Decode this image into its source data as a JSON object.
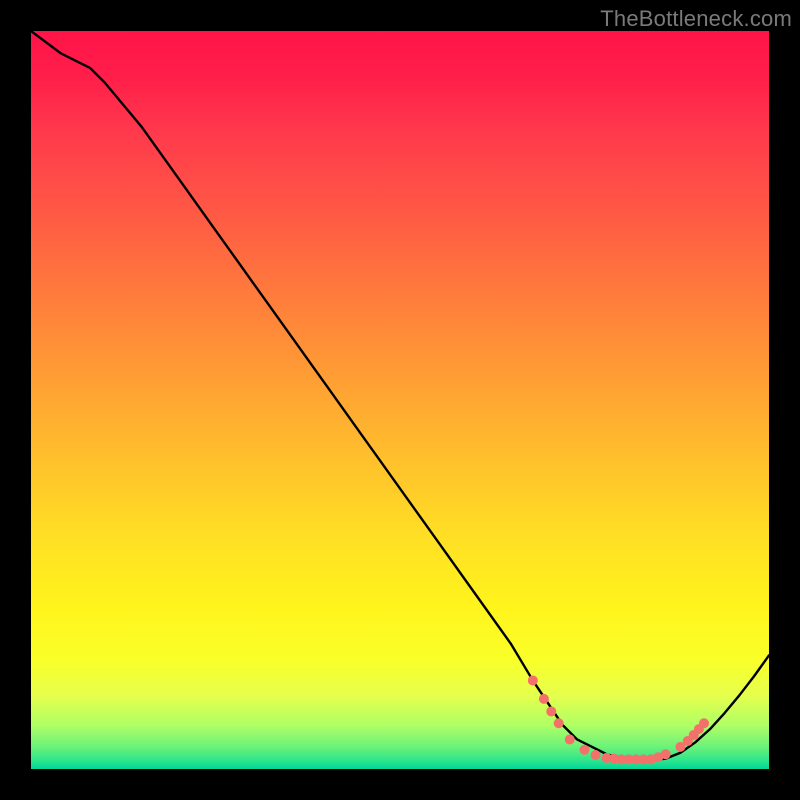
{
  "watermark": "TheBottleneck.com",
  "chart_data": {
    "type": "line",
    "title": "",
    "xlabel": "",
    "ylabel": "",
    "xlim": [
      0,
      100
    ],
    "ylim": [
      0,
      100
    ],
    "series": [
      {
        "name": "bottleneck-curve",
        "x": [
          0,
          4,
          8,
          10,
          15,
          20,
          25,
          30,
          35,
          40,
          45,
          50,
          55,
          60,
          65,
          68,
          70,
          72,
          74,
          76,
          78,
          80,
          82,
          84,
          86,
          88,
          90,
          92,
          94,
          96,
          98,
          100
        ],
        "y": [
          100,
          97,
          95,
          93,
          87,
          80,
          73,
          66,
          59,
          52,
          45,
          38,
          31,
          24,
          17,
          12,
          9,
          6,
          4,
          3,
          2,
          1.5,
          1.3,
          1.2,
          1.4,
          2.2,
          3.6,
          5.4,
          7.6,
          10.0,
          12.6,
          15.4
        ]
      }
    ],
    "markers": {
      "name": "highlight-points",
      "color": "#f3716a",
      "points": [
        {
          "x": 68.0,
          "y": 12.0
        },
        {
          "x": 69.5,
          "y": 9.5
        },
        {
          "x": 70.5,
          "y": 7.8
        },
        {
          "x": 71.5,
          "y": 6.2
        },
        {
          "x": 73.0,
          "y": 4.0
        },
        {
          "x": 75.0,
          "y": 2.6
        },
        {
          "x": 76.5,
          "y": 1.9
        },
        {
          "x": 78.0,
          "y": 1.5
        },
        {
          "x": 79.0,
          "y": 1.4
        },
        {
          "x": 80.0,
          "y": 1.3
        },
        {
          "x": 81.0,
          "y": 1.3
        },
        {
          "x": 82.0,
          "y": 1.3
        },
        {
          "x": 83.0,
          "y": 1.3
        },
        {
          "x": 84.0,
          "y": 1.3
        },
        {
          "x": 85.0,
          "y": 1.6
        },
        {
          "x": 86.0,
          "y": 2.0
        },
        {
          "x": 88.0,
          "y": 3.0
        },
        {
          "x": 89.0,
          "y": 3.8
        },
        {
          "x": 89.8,
          "y": 4.6
        },
        {
          "x": 90.5,
          "y": 5.4
        },
        {
          "x": 91.2,
          "y": 6.2
        }
      ]
    }
  }
}
